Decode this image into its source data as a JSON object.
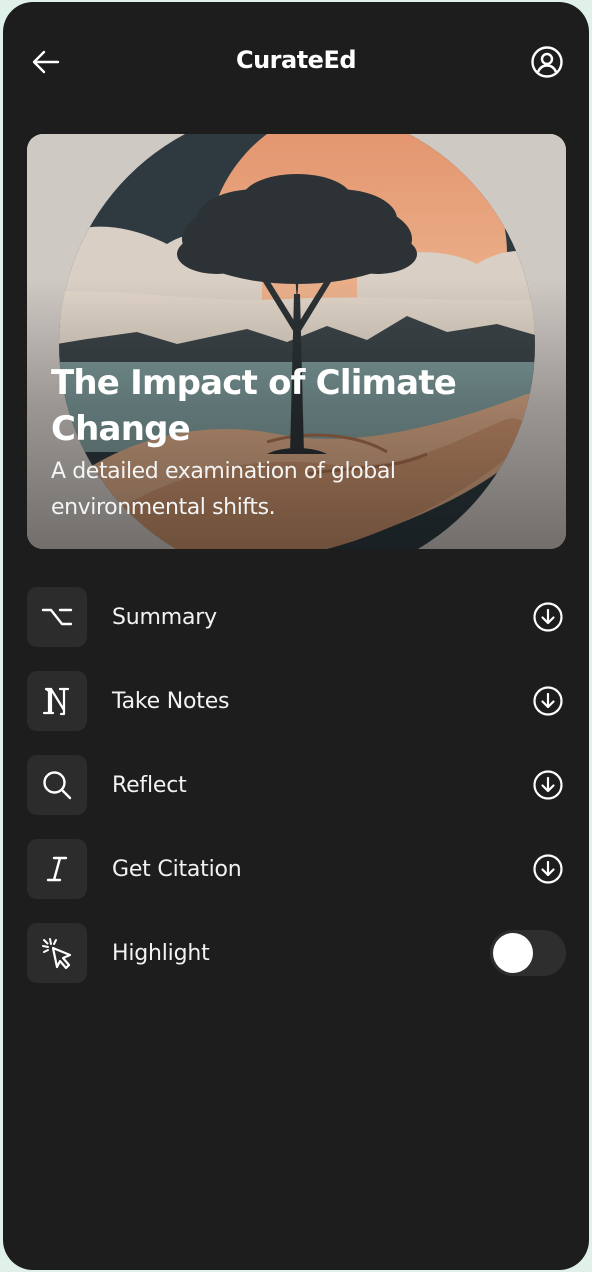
{
  "header": {
    "title": "CurateEd",
    "back_icon": "arrow-left-icon",
    "profile_icon": "user-circle-icon"
  },
  "hero": {
    "title": "The Impact of Climate Change",
    "subtitle": "A detailed examination of global environmental shifts.",
    "image": "tree-in-hands-illustration"
  },
  "menu": {
    "items": [
      {
        "label": "Summary",
        "icon": "option-key-icon",
        "action_icon": "download-circle-icon"
      },
      {
        "label": "Take Notes",
        "icon": "notion-logo-icon",
        "action_icon": "download-circle-icon"
      },
      {
        "label": "Reflect",
        "icon": "search-icon",
        "action_icon": "download-circle-icon"
      },
      {
        "label": "Get Citation",
        "icon": "italic-icon",
        "action_icon": "download-circle-icon"
      },
      {
        "label": "Highlight",
        "icon": "cursor-click-icon",
        "toggle_on": false
      }
    ]
  },
  "colors": {
    "background": "#1d1d1d",
    "icon_tile": "#2c2c2c",
    "text": "#ffffff",
    "sun": "#e09a6a",
    "outer_frame": "#dff1e8"
  }
}
